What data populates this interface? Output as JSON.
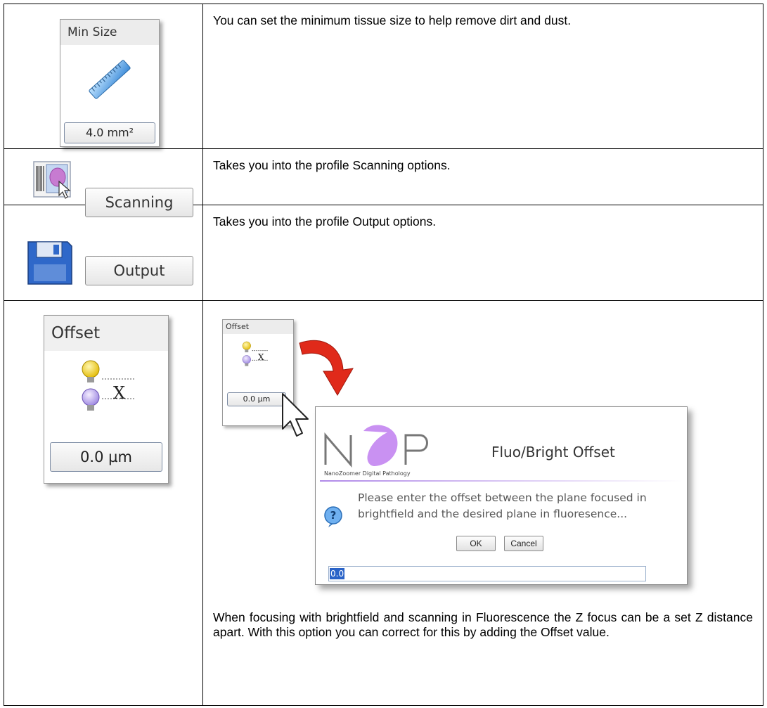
{
  "rows": [
    {
      "panel_title": "Min Size",
      "panel_value": "4.0 mm²",
      "description": "You can set the minimum tissue size to help remove dirt and dust."
    },
    {
      "button_label": "Scanning",
      "description": "Takes you into the profile Scanning options."
    },
    {
      "button_label": "Output",
      "description": "Takes you into the profile Output options."
    },
    {
      "panel_title": "Offset",
      "panel_value": "0.0 µm",
      "symbol": "X",
      "small_panel_title": "Offset",
      "small_panel_value": "0.0 µm",
      "dialog": {
        "logo_text": "NDP",
        "logo_subtitle": "NanoZoomer Digital Pathology",
        "title": "Fluo/Bright Offset",
        "message": "Please enter the offset between the plane focused in brightfield and the desired plane in fluoresence...",
        "input_value": "0.0",
        "ok_label": "OK",
        "cancel_label": "Cancel"
      },
      "description": "When focusing with brightfield and scanning in Fluorescence the Z focus can be a set Z distance apart.  With this option you can correct for this by adding the Offset value."
    }
  ]
}
